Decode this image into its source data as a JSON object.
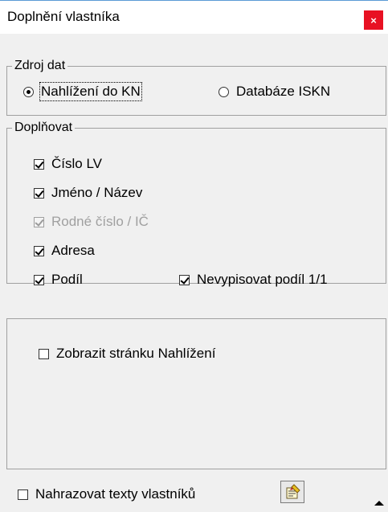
{
  "window": {
    "title": "Doplnění vlastníka",
    "close_label": "×"
  },
  "zdroj_dat": {
    "legend": "Zdroj dat",
    "options": [
      {
        "label": "Nahlížení do KN",
        "selected": true
      },
      {
        "label": "Databáze ISKN",
        "selected": false
      }
    ]
  },
  "doplnovat": {
    "legend": "Doplňovat",
    "items": [
      {
        "label": "Číslo LV",
        "checked": true,
        "enabled": true
      },
      {
        "label": "Jméno / Název",
        "checked": true,
        "enabled": true
      },
      {
        "label": "Rodné číslo / IČ",
        "checked": true,
        "enabled": false
      },
      {
        "label": "Adresa",
        "checked": true,
        "enabled": true
      },
      {
        "label": "Podíl",
        "checked": true,
        "enabled": true
      },
      {
        "label": "Nevypisovat podíl 1/1",
        "checked": true,
        "enabled": true
      }
    ]
  },
  "panel": {
    "show_page_label": "Zobrazit stránku Nahlížení",
    "show_page_checked": false
  },
  "footer": {
    "replace_texts_label": "Nahrazovat texty vlastníků",
    "replace_texts_checked": false,
    "tool_icon": "edit-texts-icon"
  }
}
